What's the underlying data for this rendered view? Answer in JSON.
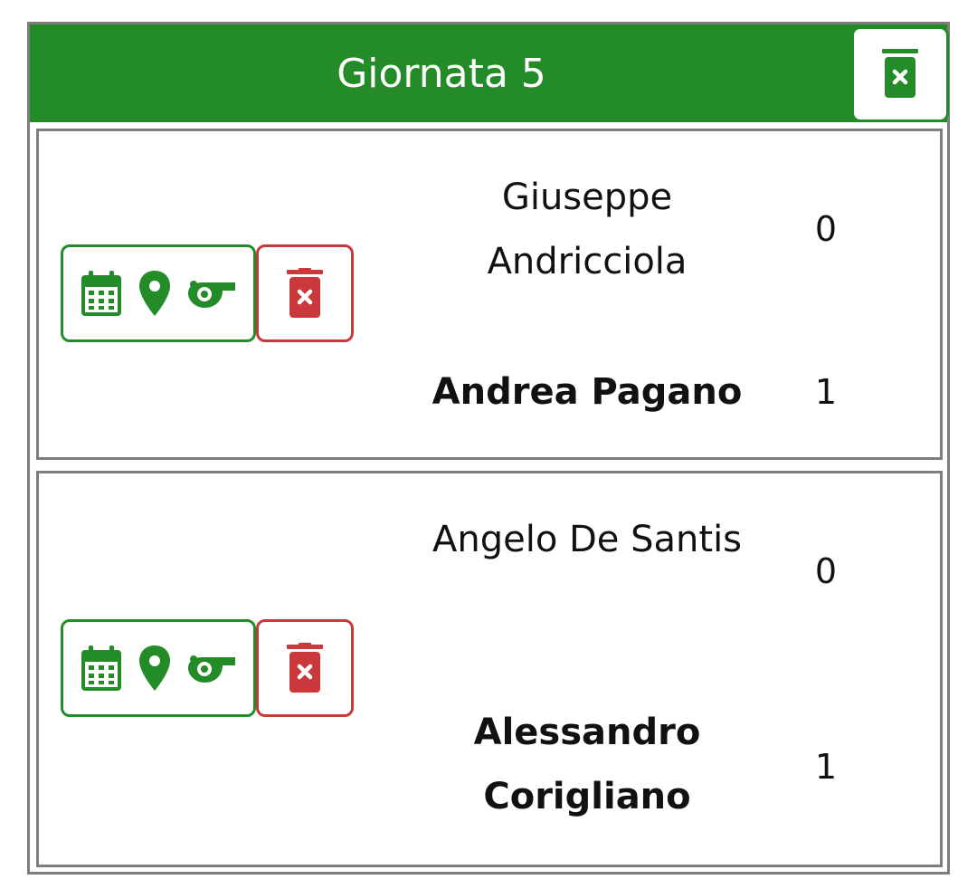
{
  "round": {
    "title": "Giornata 5",
    "delete_icon": "trash-x-icon"
  },
  "colors": {
    "primary_green": "#238b27",
    "danger_red": "#c9393c",
    "border_gray": "#7d7d7d"
  },
  "matches": [
    {
      "actions": [
        "calendar-icon",
        "map-pin-icon",
        "whistle-icon"
      ],
      "delete_icon": "trash-x-icon",
      "home": {
        "name": "Giuseppe Andricciola",
        "score": "0",
        "winner": false
      },
      "away": {
        "name": "Andrea Pagano",
        "score": "1",
        "winner": true
      }
    },
    {
      "actions": [
        "calendar-icon",
        "map-pin-icon",
        "whistle-icon"
      ],
      "delete_icon": "trash-x-icon",
      "home": {
        "name": "Angelo De Santis",
        "score": "0",
        "winner": false
      },
      "away": {
        "name": "Alessandro Corigliano",
        "score": "1",
        "winner": true
      }
    }
  ]
}
